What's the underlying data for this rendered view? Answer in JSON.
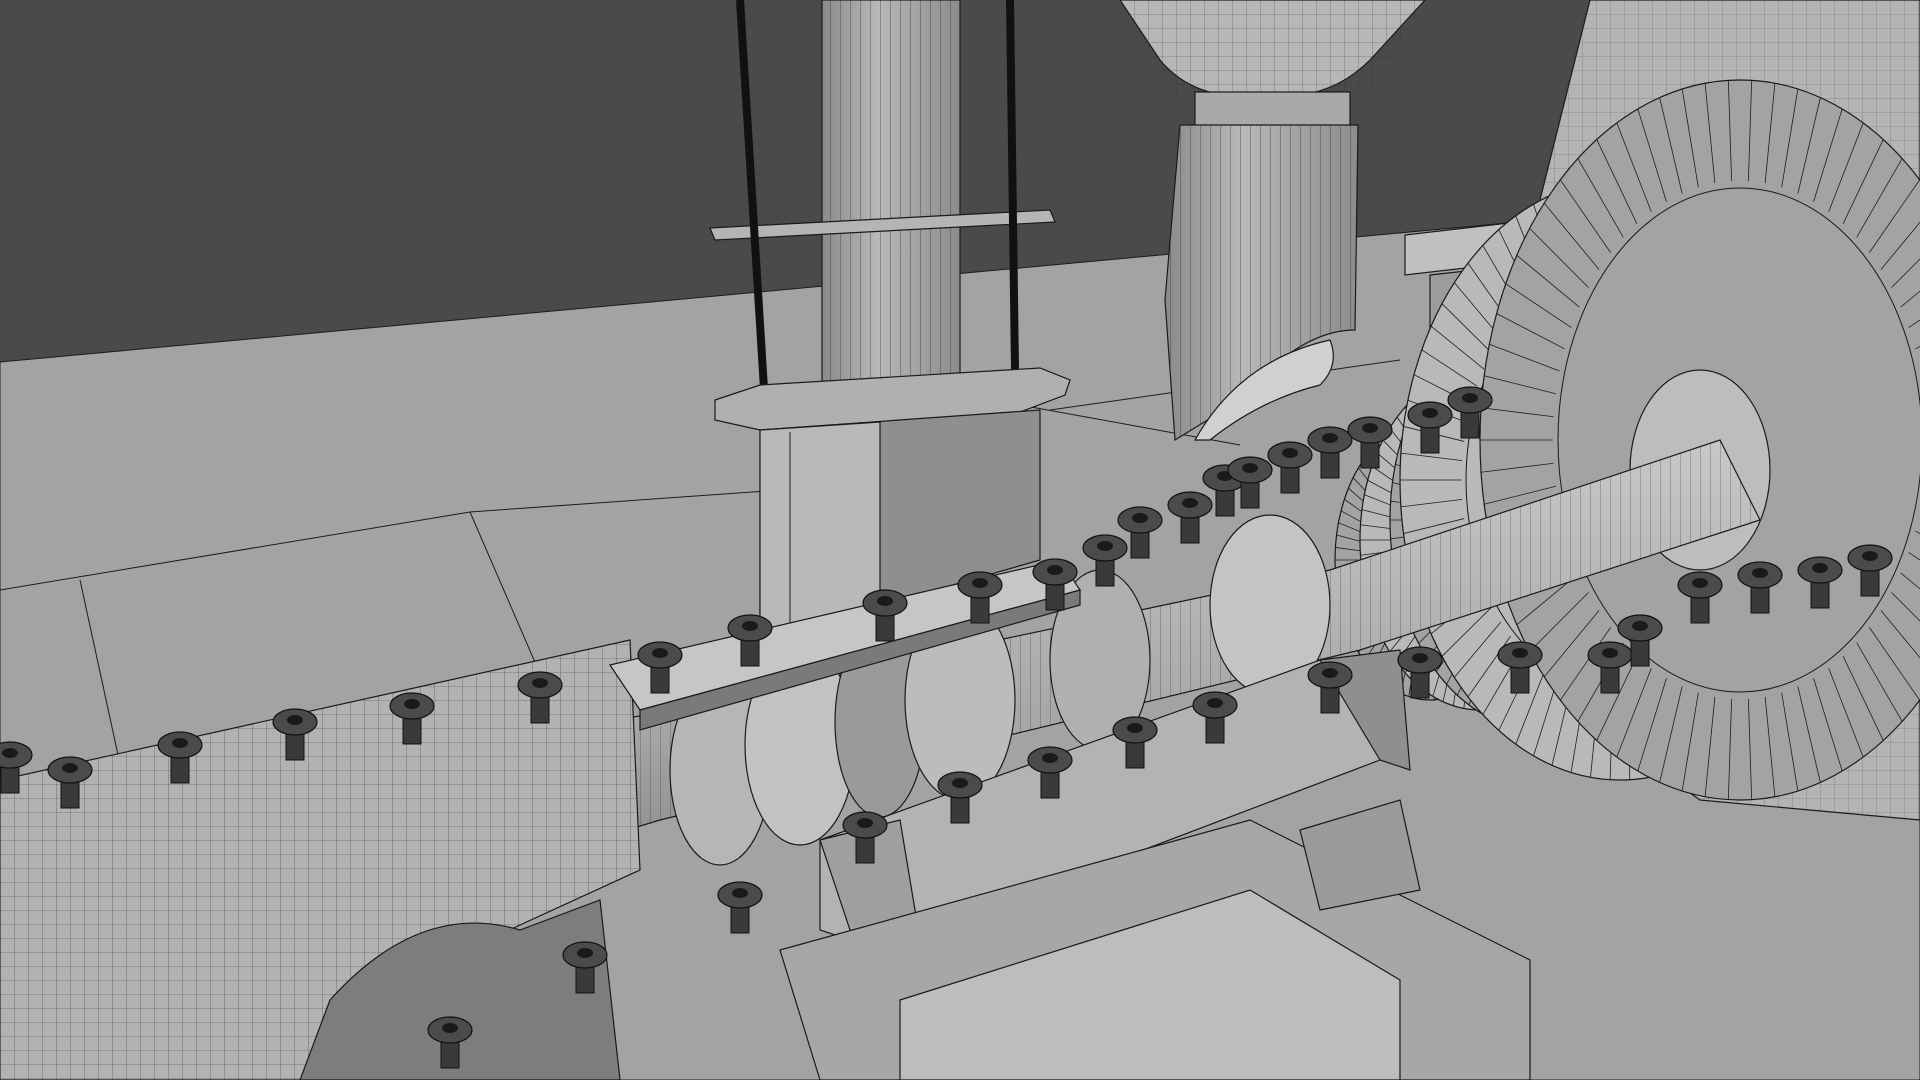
{
  "scene": {
    "kind": "3d-wireframe-viewport",
    "subject": "steam-turbine-assembly",
    "colors": {
      "backdrop": "#4a4a4a",
      "floor": "#9e9e9e",
      "mesh_fill": "#a8a8a8",
      "mesh_light": "#c4c4c4",
      "mesh_dark": "#6e6e6e",
      "wire": "#1c1c1c"
    },
    "icons": [
      "bolt-icon"
    ]
  }
}
